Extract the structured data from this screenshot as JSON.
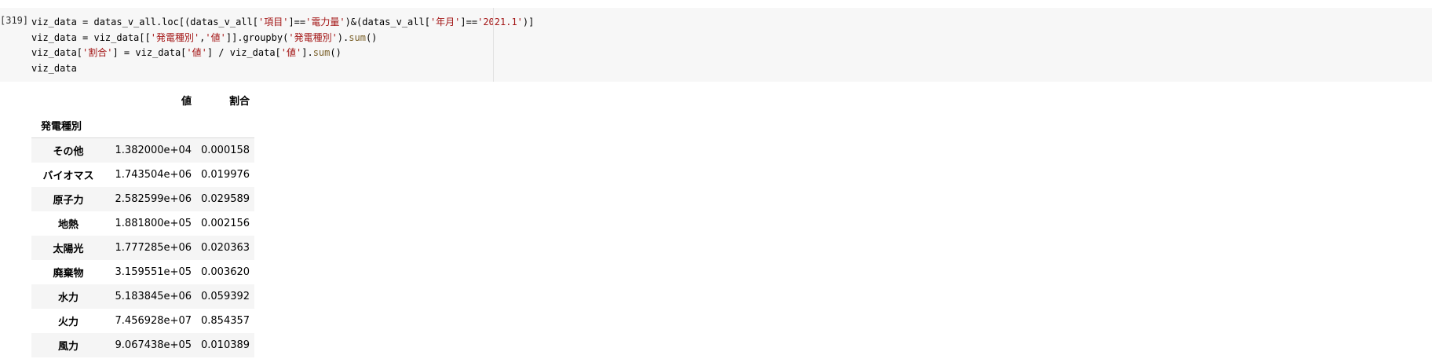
{
  "cell": {
    "execution_count": "[319]",
    "code_lines": [
      [
        {
          "t": "viz_data = datas_v_all.loc[(datas_v_all[",
          "c": ""
        },
        {
          "t": "'項目'",
          "c": "str"
        },
        {
          "t": "]==",
          "c": ""
        },
        {
          "t": "'電力量'",
          "c": "str"
        },
        {
          "t": ")&(datas_v_all[",
          "c": ""
        },
        {
          "t": "'年月'",
          "c": "str"
        },
        {
          "t": "]==",
          "c": ""
        },
        {
          "t": "'2021.1'",
          "c": "str"
        },
        {
          "t": ")]",
          "c": ""
        }
      ],
      [
        {
          "t": "viz_data = viz_data[[",
          "c": ""
        },
        {
          "t": "'発電種別'",
          "c": "str"
        },
        {
          "t": ",",
          "c": ""
        },
        {
          "t": "'値'",
          "c": "str"
        },
        {
          "t": "]].groupby(",
          "c": ""
        },
        {
          "t": "'発電種別'",
          "c": "str"
        },
        {
          "t": ").",
          "c": ""
        },
        {
          "t": "sum",
          "c": "fn"
        },
        {
          "t": "()",
          "c": ""
        }
      ],
      [
        {
          "t": "viz_data[",
          "c": ""
        },
        {
          "t": "'割合'",
          "c": "str"
        },
        {
          "t": "] = viz_data[",
          "c": ""
        },
        {
          "t": "'値'",
          "c": "str"
        },
        {
          "t": "] / viz_data[",
          "c": ""
        },
        {
          "t": "'値'",
          "c": "str"
        },
        {
          "t": "].",
          "c": ""
        },
        {
          "t": "sum",
          "c": "fn"
        },
        {
          "t": "()",
          "c": ""
        }
      ],
      [
        {
          "t": "viz_data",
          "c": ""
        }
      ]
    ]
  },
  "output": {
    "columns": [
      "値",
      "割合"
    ],
    "index_name": "発電種別",
    "rows": [
      {
        "index": "その他",
        "value": "1.382000e+04",
        "ratio": "0.000158"
      },
      {
        "index": "バイオマス",
        "value": "1.743504e+06",
        "ratio": "0.019976"
      },
      {
        "index": "原子力",
        "value": "2.582599e+06",
        "ratio": "0.029589"
      },
      {
        "index": "地熱",
        "value": "1.881800e+05",
        "ratio": "0.002156"
      },
      {
        "index": "太陽光",
        "value": "1.777285e+06",
        "ratio": "0.020363"
      },
      {
        "index": "廃棄物",
        "value": "3.159551e+05",
        "ratio": "0.003620"
      },
      {
        "index": "水力",
        "value": "5.183845e+06",
        "ratio": "0.059392"
      },
      {
        "index": "火力",
        "value": "7.456928e+07",
        "ratio": "0.854357"
      },
      {
        "index": "風力",
        "value": "9.067438e+05",
        "ratio": "0.010389"
      }
    ]
  },
  "colors": {
    "code_bg": "#f7f7f7",
    "string": "#a31515",
    "function": "#795e26",
    "row_stripe": "#f5f5f5"
  }
}
